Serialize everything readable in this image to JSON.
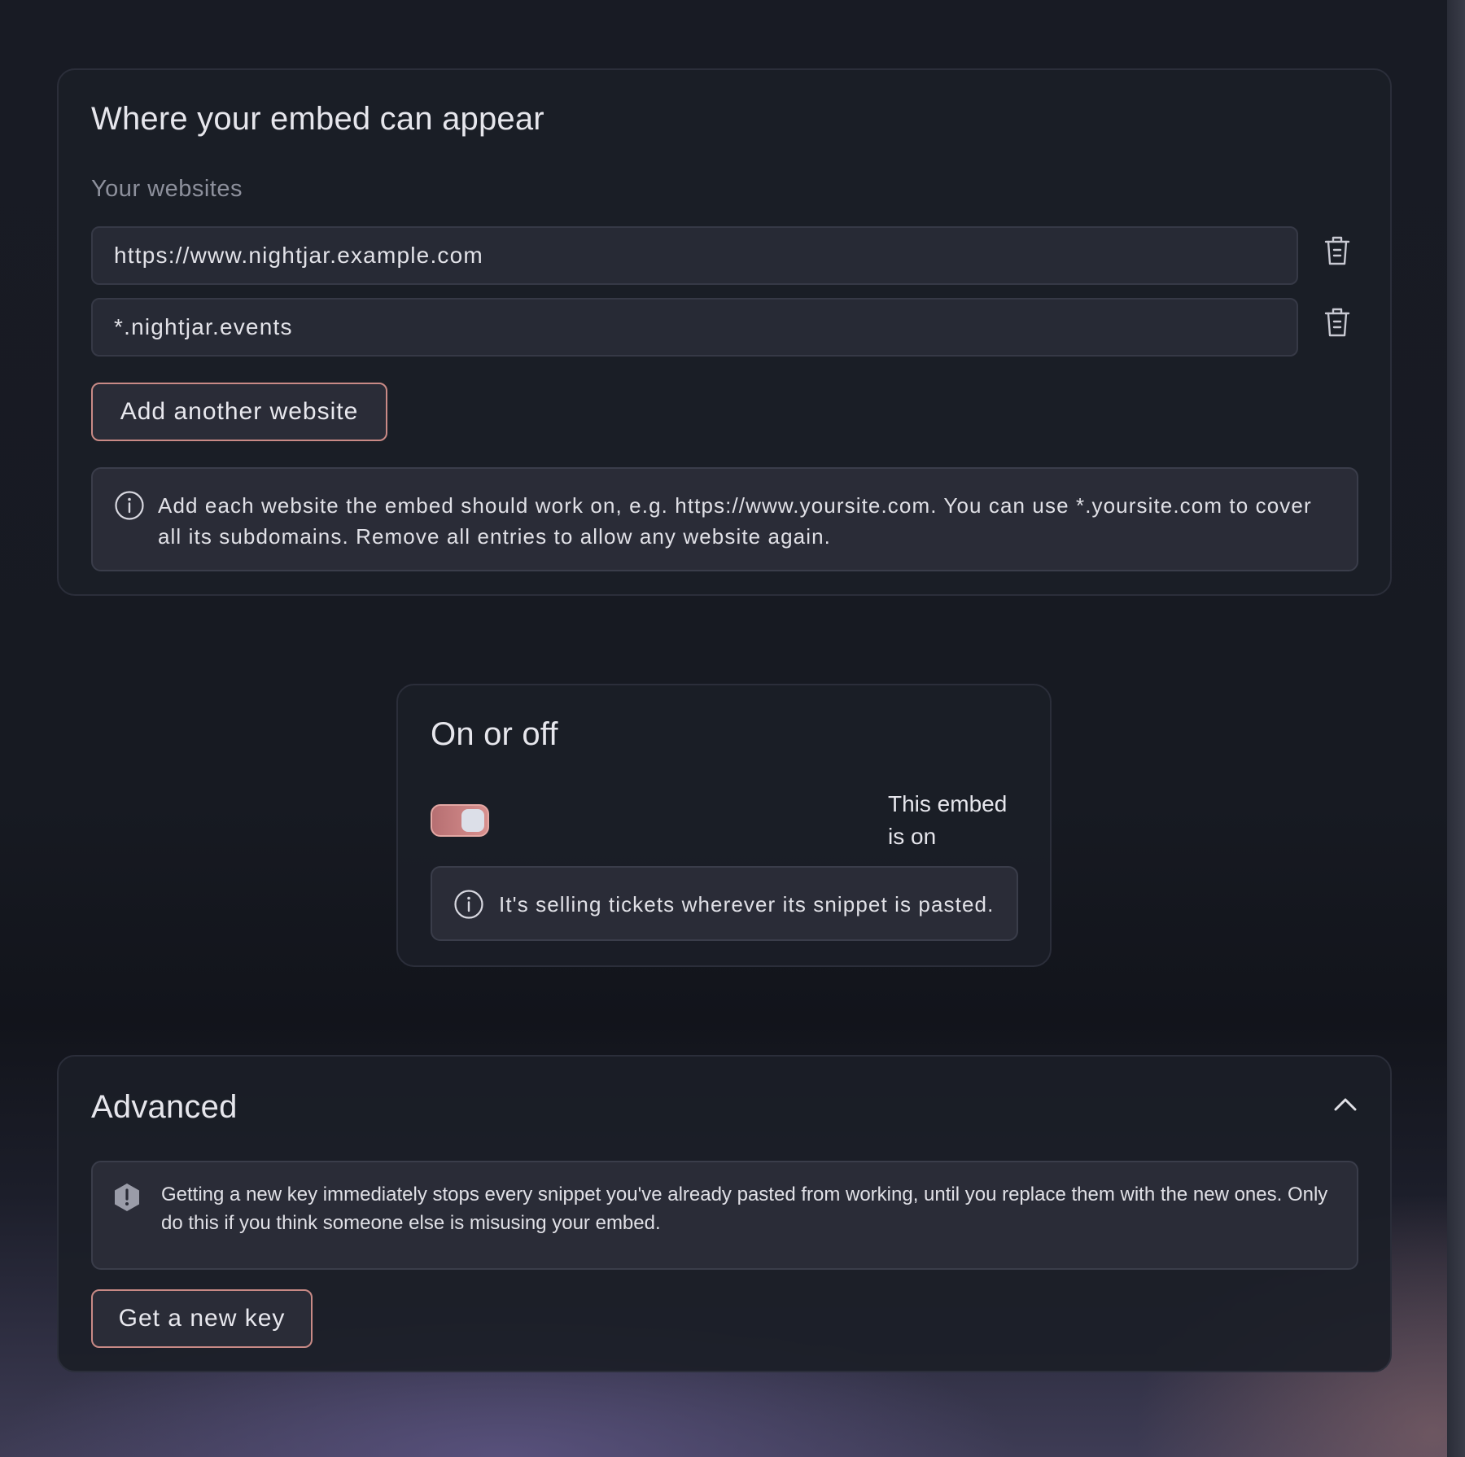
{
  "websites_card": {
    "title": "Where your embed can appear",
    "subtitle": "Your websites",
    "entries": [
      {
        "value": "https://www.nightjar.example.com",
        "delete_icon": "trash-icon"
      },
      {
        "value": "*.nightjar.events",
        "delete_icon": "trash-icon"
      }
    ],
    "add_button_label": "Add another website",
    "info_icon": "info-circle-icon",
    "info_text": "Add each website the embed should work on, e.g. https://www.yoursite.com. You can use *.yoursite.com to cover all its subdomains. Remove all entries to allow any website again."
  },
  "status_card": {
    "title": "On or off",
    "toggle_on": true,
    "status_label": "This embed is on",
    "info_icon": "info-circle-icon",
    "info_text": "It's selling tickets wherever its snippet is pasted."
  },
  "advanced_card": {
    "title": "Advanced",
    "collapse_icon": "chevron-up-icon",
    "warning_icon": "warning-hexagon-icon",
    "warning_text": "Getting a new key immediately stops every snippet you've already pasted from working, until you replace them with the new ones. Only do this if you think someone else is misusing your embed.",
    "new_key_button_label": "Get a new key"
  },
  "colors": {
    "accent_border": "#c98a86",
    "toggle_fill": "#d08a88",
    "background": "#171a22"
  }
}
